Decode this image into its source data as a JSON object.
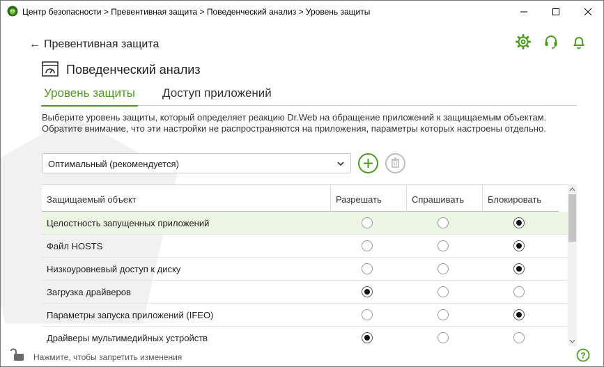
{
  "window": {
    "title": "Центр безопасности > Превентивная защита > Поведенческий анализ > Уровень защиты",
    "app_icon": "drweb-spider-icon",
    "controls": [
      "minimize-icon",
      "maximize-icon",
      "close-icon"
    ]
  },
  "header_icons": [
    "gear-icon",
    "headset-support-icon",
    "bell-icon"
  ],
  "nav": {
    "back_label": "Превентивная защита",
    "section_title": "Поведенческий анализ",
    "section_icon": "behavior-analysis-icon"
  },
  "tabs": [
    {
      "label": "Уровень защиты",
      "active": true
    },
    {
      "label": "Доступ приложений",
      "active": false
    }
  ],
  "description": "Выберите уровень защиты, который определяет реакцию Dr.Web на обращение приложений к защищаемым объектам. Обратите внимание, что эти настройки не распространяются на приложения, параметры которых настроены отдельно.",
  "profile_select": {
    "value": "Оптимальный (рекомендуется)",
    "add_icon": "plus-icon",
    "delete_icon": "trash-icon"
  },
  "table": {
    "columns": [
      "Защищаемый объект",
      "Разрешать",
      "Спрашивать",
      "Блокировать"
    ],
    "rows": [
      {
        "label": "Целостность запущенных приложений",
        "choice": "Блокировать",
        "selected": true
      },
      {
        "label": "Файл HOSTS",
        "choice": "Блокировать",
        "selected": false
      },
      {
        "label": "Низкоуровневый доступ к диску",
        "choice": "Блокировать",
        "selected": false
      },
      {
        "label": "Загрузка драйверов",
        "choice": "Разрешать",
        "selected": false
      },
      {
        "label": "Параметры запуска приложений (IFEO)",
        "choice": "Блокировать",
        "selected": false
      },
      {
        "label": "Драйверы мультимедийных устройств",
        "choice": "Разрешать",
        "selected": false
      }
    ]
  },
  "footer": {
    "lock_text": "Нажмите, чтобы запретить изменения",
    "lock_icon": "unlocked-padlock-icon",
    "help_icon": "help-icon"
  },
  "colors": {
    "accent": "#4d9a23",
    "selected_row": "#ebf5e3"
  }
}
